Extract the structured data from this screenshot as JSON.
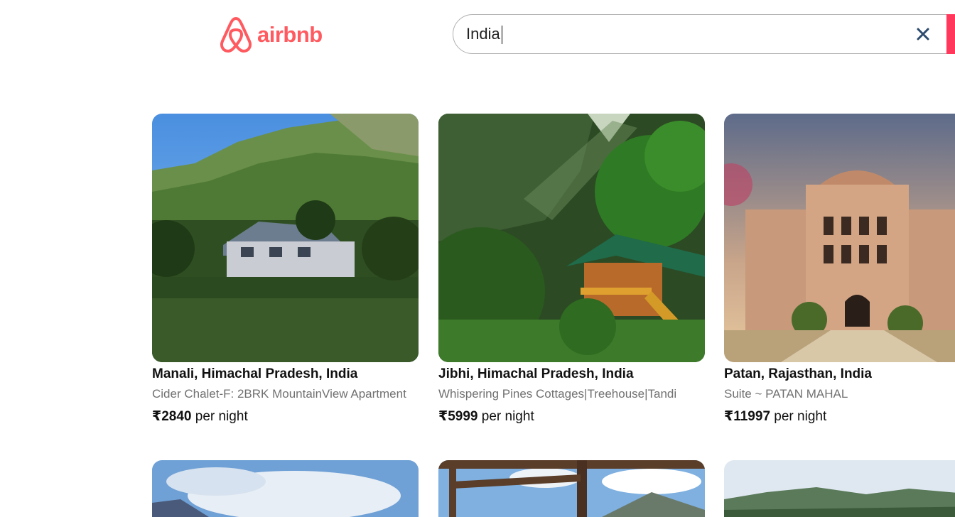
{
  "header": {
    "logo_text": "airbnb",
    "search": {
      "value": "India",
      "placeholder": ""
    },
    "clear_icon": "close-icon",
    "brand_color": "#ff5a5f",
    "accent_color": "#ff385c"
  },
  "listings": [
    {
      "title": "Manali, Himachal Pradesh, India",
      "subtitle": "Cider Chalet-F: 2BRK MountainView Apartment",
      "price": "₹2840",
      "price_suffix": "per night"
    },
    {
      "title": "Jibhi, Himachal Pradesh, India",
      "subtitle": "Whispering Pines Cottages|Treehouse|Tandi",
      "price": "₹5999",
      "price_suffix": "per night"
    },
    {
      "title": "Patan, Rajasthan, India",
      "subtitle": "Suite ~ PATAN MAHAL",
      "price": "₹11997",
      "price_suffix": "per night"
    }
  ]
}
